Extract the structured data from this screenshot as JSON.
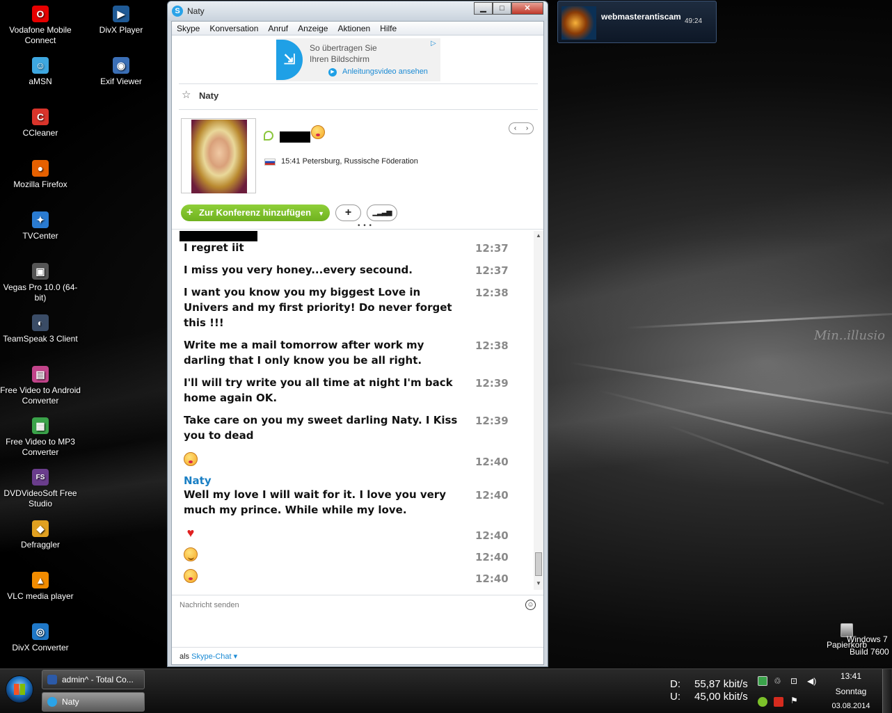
{
  "desktop_icons": [
    {
      "label": "Vodafone Mobile Connect",
      "icon": "vodafone-icon",
      "color": "#e60000",
      "glyph": "O"
    },
    {
      "label": "aMSN",
      "icon": "amsn-icon",
      "color": "#3ea7e0",
      "glyph": "☺"
    },
    {
      "label": "CCleaner",
      "icon": "ccleaner-icon",
      "color": "#d9342b",
      "glyph": "C"
    },
    {
      "label": "Mozilla Firefox",
      "icon": "firefox-icon",
      "color": "#e66000",
      "glyph": "●"
    },
    {
      "label": "TVCenter",
      "icon": "tvcenter-icon",
      "color": "#2a7bd1",
      "glyph": "✦"
    },
    {
      "label": "Vegas Pro 10.0 (64-bit)",
      "icon": "vegas-icon",
      "color": "#555555",
      "glyph": "▣"
    },
    {
      "label": "TeamSpeak 3 Client",
      "icon": "teamspeak-icon",
      "color": "#3a4c66",
      "glyph": "◐"
    },
    {
      "label": "Free Video to Android Converter",
      "icon": "android-converter-icon",
      "color": "#c2448a",
      "glyph": "▤"
    },
    {
      "label": "Free Video to MP3 Converter",
      "icon": "mp3-converter-icon",
      "color": "#3aa34a",
      "glyph": "▦"
    },
    {
      "label": "DVDVideoSoft Free Studio",
      "icon": "dvdvideosoft-icon",
      "color": "#6a3d8c",
      "glyph": "FS"
    },
    {
      "label": "Defraggler",
      "icon": "defraggler-icon",
      "color": "#e0a020",
      "glyph": "◆"
    },
    {
      "label": "VLC media player",
      "icon": "vlc-icon",
      "color": "#f28c00",
      "glyph": "▲"
    },
    {
      "label": "DivX Converter",
      "icon": "divx-converter-icon",
      "color": "#1f78c8",
      "glyph": "◎"
    },
    {
      "label": "DivX Player",
      "icon": "divx-player-icon",
      "color": "#1f5a96",
      "glyph": "▶"
    },
    {
      "label": "Exif Viewer",
      "icon": "exif-viewer-icon",
      "color": "#3b6fb6",
      "glyph": "◉"
    }
  ],
  "skype": {
    "window_title": "Naty",
    "menu": [
      "Skype",
      "Konversation",
      "Anruf",
      "Anzeige",
      "Aktionen",
      "Hilfe"
    ],
    "ad": {
      "line1": "So übertragen Sie",
      "line2": "Ihren Bildschirm",
      "link": "Anleitungsvideo ansehen"
    },
    "contact": {
      "name": "Naty",
      "location": "15:41 Petersburg, Russische Föderation"
    },
    "buttons": {
      "conference": "Zur Konferenz hinzufügen",
      "add": "+",
      "call_quality": "signal-bars-icon"
    },
    "messages": [
      {
        "text": "I regret iit",
        "time": "12:37"
      },
      {
        "text": "I miss you very honey...every secound.",
        "time": "12:37"
      },
      {
        "text": "I want you know you my biggest Love in Univers and my first priority!   Do never forget this !!!",
        "time": "12:38"
      },
      {
        "text": "Write me a mail tomorrow after work my darling that I only know you be all right.",
        "time": "12:38"
      },
      {
        "text": "I'll will try write you all time at night I'm back home again OK.",
        "time": "12:39"
      },
      {
        "text": "Take care on you my sweet darling Naty. I Kiss you to dead",
        "time": "12:39"
      },
      {
        "emoji": "kiss-emoji",
        "time": "12:40"
      },
      {
        "sender": "Naty"
      },
      {
        "text": "Well my love I will wait for it. I love you very much my prince. While while my love.",
        "time": "12:40"
      },
      {
        "emoji": "heart-emoji",
        "time": "12:40"
      },
      {
        "emoji": "smile-emoji",
        "time": "12:40"
      },
      {
        "emoji": "kiss-emoji",
        "time": "12:40"
      }
    ],
    "input_placeholder": "Nachricht senden",
    "footer_prefix": "als",
    "footer_link": "Skype-Chat"
  },
  "notification": {
    "name": "webmasterantiscam",
    "time": "49:24"
  },
  "desktop": {
    "recycle_bin": "Papierkorb",
    "os_line1": "Windows 7",
    "os_line2": "Build 7600",
    "watermark": "Min..illusio"
  },
  "taskbar": {
    "items": [
      {
        "label": "admin^ - Total Co...",
        "active": false
      },
      {
        "label": "Naty",
        "active": true
      }
    ],
    "net_down_label": "D:",
    "net_down": "55,87 kbit/s",
    "net_up_label": "U:",
    "net_up": "45,00 kbit/s",
    "time": "13:41",
    "day": "Sonntag",
    "date": "03.08.2014"
  },
  "colors": {
    "skype_blue": "#1a8ad4",
    "skype_green": "#7cc12a",
    "sender_blue": "#1a7fc4"
  }
}
